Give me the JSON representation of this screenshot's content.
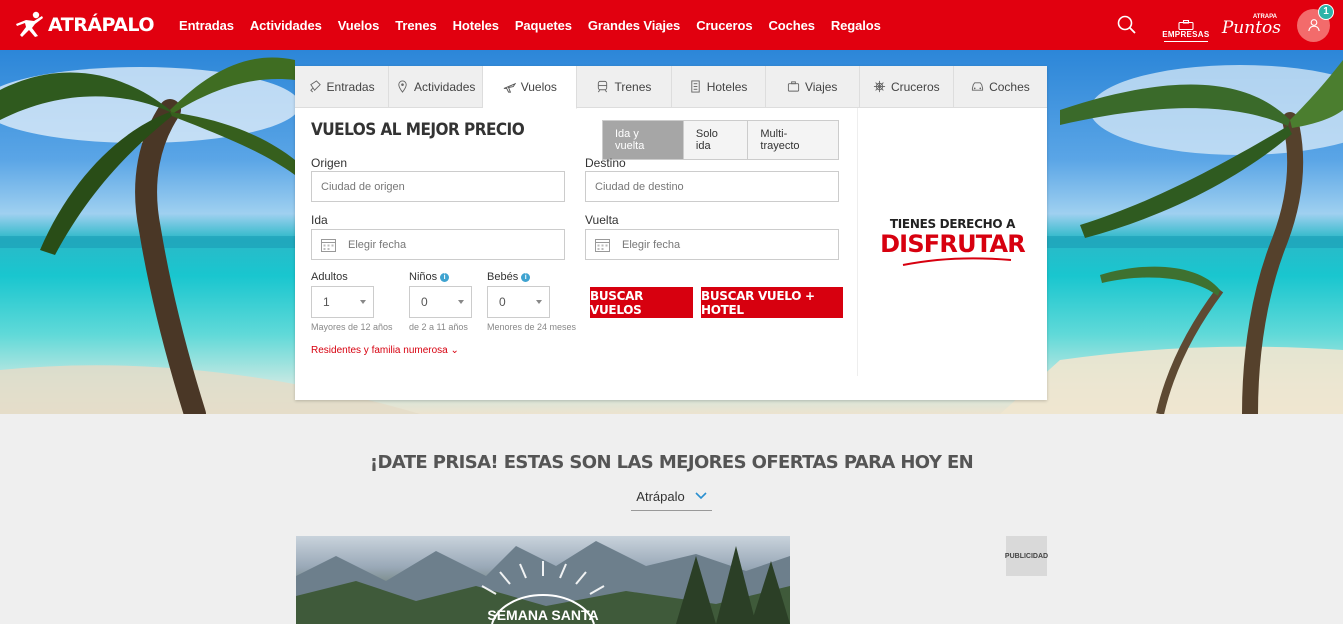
{
  "brand": {
    "name": "ATRÁPALO",
    "primary_color": "#e1000f"
  },
  "nav": [
    "Entradas",
    "Actividades",
    "Vuelos",
    "Trenes",
    "Hoteles",
    "Paquetes",
    "Grandes Viajes",
    "Cruceros",
    "Coches",
    "Regalos"
  ],
  "top_right": {
    "search_icon": "search-icon",
    "empresas_label": "EMPRESAS",
    "puntos_small": "ATRAPA",
    "puntos_big": "Puntos",
    "user_badge": "1"
  },
  "search_panel": {
    "tabs": [
      {
        "label": "Entradas",
        "icon": "ticket-icon"
      },
      {
        "label": "Actividades",
        "icon": "location-pin-icon"
      },
      {
        "label": "Vuelos",
        "icon": "plane-icon",
        "active": true
      },
      {
        "label": "Trenes",
        "icon": "train-icon"
      },
      {
        "label": "Hoteles",
        "icon": "hotel-icon"
      },
      {
        "label": "Viajes",
        "icon": "suitcase-icon"
      },
      {
        "label": "Cruceros",
        "icon": "ship-wheel-icon"
      },
      {
        "label": "Coches",
        "icon": "car-icon"
      }
    ],
    "title": "VUELOS AL MEJOR PRECIO",
    "trip_types": [
      "Ida y vuelta",
      "Solo ida",
      "Multi-trayecto"
    ],
    "trip_type_selected": "Ida y vuelta",
    "origen_label": "Origen",
    "origen_placeholder": "Ciudad de origen",
    "destino_label": "Destino",
    "destino_placeholder": "Ciudad de destino",
    "ida_label": "Ida",
    "ida_placeholder": "Elegir fecha",
    "vuelta_label": "Vuelta",
    "vuelta_placeholder": "Elegir fecha",
    "adultos_label": "Adultos",
    "adultos_value": "1",
    "adultos_hint": "Mayores de 12 años",
    "ninos_label": "Niños",
    "ninos_value": "0",
    "ninos_hint": "de 2 a 11 años",
    "bebes_label": "Bebés",
    "bebes_value": "0",
    "bebes_hint": "Menores de 24 meses",
    "buscar_vuelos": "BUSCAR VUELOS",
    "buscar_vuelo_hotel": "BUSCAR VUELO + HOTEL",
    "residentes_link": "Residentes y familia numerosa",
    "promo_line1": "TIENES DERECHO A",
    "promo_line2": "DISFRUTAR"
  },
  "offers": {
    "title": "¡DATE PRISA! ESTAS SON LAS MEJORES OFERTAS PARA HOY EN",
    "location": "Atrápalo",
    "banner_text": "SEMANA SANTA",
    "publicidad": "PUBLICIDAD"
  }
}
